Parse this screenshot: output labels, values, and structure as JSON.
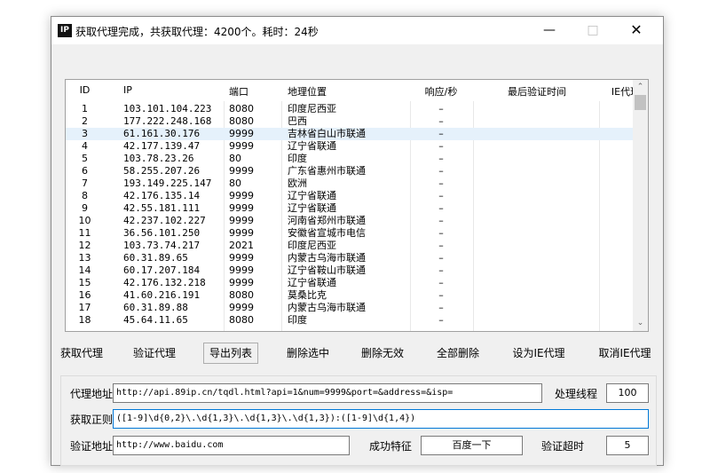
{
  "window": {
    "app_icon_text": "IP",
    "title": "获取代理完成，共获取代理：4200个。耗时：24秒",
    "minimize": "—",
    "maximize": "□",
    "close": "✕"
  },
  "table": {
    "headers": {
      "id": "ID",
      "ip": "IP",
      "port": "端口",
      "location": "地理位置",
      "response": "响应/秒",
      "last_check": "最后验证时间",
      "ie": "IE代理"
    },
    "rows": [
      {
        "id": "1",
        "ip": "103.101.104.223",
        "port": "8080",
        "location": "印度尼西亚",
        "response": "–"
      },
      {
        "id": "2",
        "ip": "177.222.248.168",
        "port": "8080",
        "location": "巴西",
        "response": "–"
      },
      {
        "id": "3",
        "ip": "61.161.30.176",
        "port": "9999",
        "location": "吉林省白山市联通",
        "response": "–"
      },
      {
        "id": "4",
        "ip": "42.177.139.47",
        "port": "9999",
        "location": "辽宁省联通",
        "response": "–"
      },
      {
        "id": "5",
        "ip": "103.78.23.26",
        "port": "80",
        "location": "印度",
        "response": "–"
      },
      {
        "id": "6",
        "ip": "58.255.207.26",
        "port": "9999",
        "location": "广东省惠州市联通",
        "response": "–"
      },
      {
        "id": "7",
        "ip": "193.149.225.147",
        "port": "80",
        "location": "欧洲",
        "response": "–"
      },
      {
        "id": "8",
        "ip": "42.176.135.14",
        "port": "9999",
        "location": "辽宁省联通",
        "response": "–"
      },
      {
        "id": "9",
        "ip": "42.55.181.111",
        "port": "9999",
        "location": "辽宁省联通",
        "response": "–"
      },
      {
        "id": "10",
        "ip": "42.237.102.227",
        "port": "9999",
        "location": "河南省郑州市联通",
        "response": "–"
      },
      {
        "id": "11",
        "ip": "36.56.101.250",
        "port": "9999",
        "location": "安徽省宣城市电信",
        "response": "–"
      },
      {
        "id": "12",
        "ip": "103.73.74.217",
        "port": "2021",
        "location": "印度尼西亚",
        "response": "–"
      },
      {
        "id": "13",
        "ip": "60.31.89.65",
        "port": "9999",
        "location": "内蒙古乌海市联通",
        "response": "–"
      },
      {
        "id": "14",
        "ip": "60.17.207.184",
        "port": "9999",
        "location": "辽宁省鞍山市联通",
        "response": "–"
      },
      {
        "id": "15",
        "ip": "42.176.132.218",
        "port": "9999",
        "location": "辽宁省联通",
        "response": "–"
      },
      {
        "id": "16",
        "ip": "41.60.216.191",
        "port": "8080",
        "location": "莫桑比克",
        "response": "–"
      },
      {
        "id": "17",
        "ip": "60.31.89.88",
        "port": "9999",
        "location": "内蒙古乌海市联通",
        "response": "–"
      },
      {
        "id": "18",
        "ip": "45.64.11.65",
        "port": "8080",
        "location": "印度",
        "response": "–"
      }
    ],
    "selected_row_id": "3",
    "scroll_up": "⌃",
    "scroll_down": "⌄"
  },
  "buttons": {
    "fetch": "获取代理",
    "verify": "验证代理",
    "export": "导出列表",
    "delete_selected": "删除选中",
    "delete_invalid": "删除无效",
    "delete_all": "全部删除",
    "set_ie": "设为IE代理",
    "cancel_ie": "取消IE代理"
  },
  "settings": {
    "proxy_url_label": "代理地址",
    "proxy_url": "http://api.89ip.cn/tqdl.html?api=1&num=9999&port=&address=&isp=",
    "threads_label": "处理线程",
    "threads": "100",
    "regex_label": "获取正则",
    "regex": "([1-9]\\d{0,2}\\.\\d{1,3}\\.\\d{1,3}\\.\\d{1,3}):([1-9]\\d{1,4})",
    "verify_url_label": "验证地址",
    "verify_url": "http://www.baidu.com",
    "success_label": "成功特征",
    "success_value": "百度一下",
    "timeout_label": "验证超时",
    "timeout": "5"
  },
  "colors": {
    "selection": "#e5f1fb",
    "focus_border": "#0078d7"
  }
}
